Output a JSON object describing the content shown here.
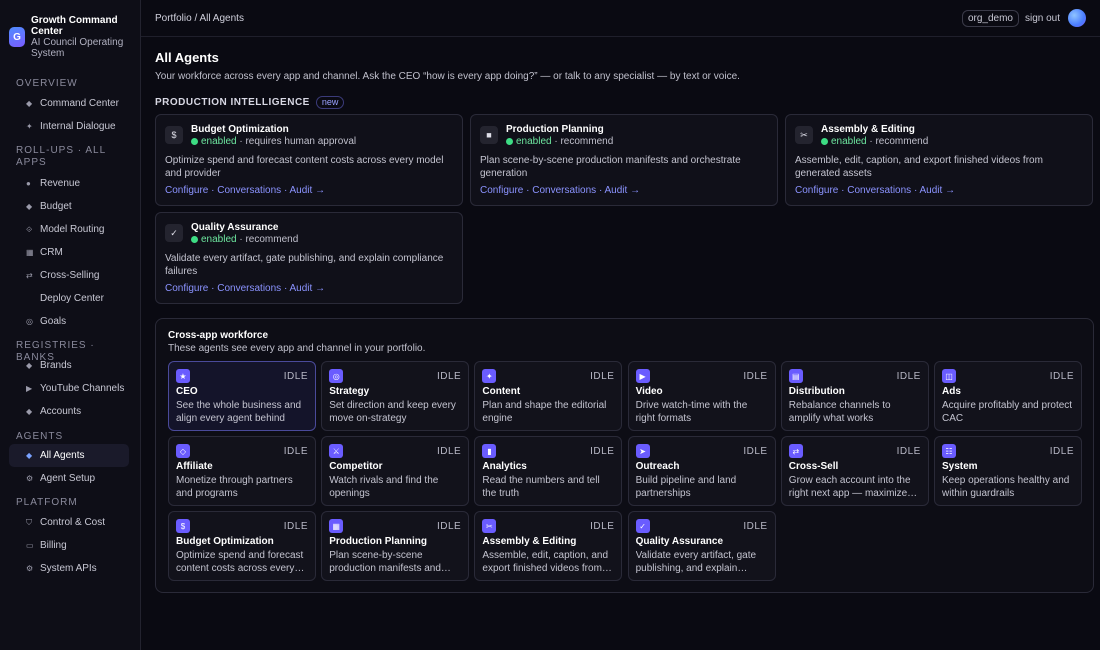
{
  "brand": {
    "logo": "G",
    "title": "Growth Command Center",
    "subtitle": "AI Council Operating System"
  },
  "sidebar": {
    "sections": [
      {
        "label": "OVERVIEW",
        "items": [
          {
            "label": "Command Center",
            "icon": "diamond-icon"
          },
          {
            "label": "Internal Dialogue",
            "icon": "sparkle-icon"
          }
        ]
      },
      {
        "label": "ROLL-UPS · ALL APPS",
        "items": [
          {
            "label": "Revenue",
            "icon": "circle-icon"
          },
          {
            "label": "Budget",
            "icon": "diamond-icon"
          },
          {
            "label": "Model Routing",
            "icon": "route-icon"
          },
          {
            "label": "CRM",
            "icon": "grid-icon"
          },
          {
            "label": "Cross-Selling",
            "icon": "swap-icon"
          },
          {
            "label": "Deploy Center",
            "icon": ""
          },
          {
            "label": "Goals",
            "icon": "target-icon"
          }
        ]
      },
      {
        "label": "REGISTRIES · BANKS",
        "items": [
          {
            "label": "Brands",
            "icon": "diamond-icon"
          },
          {
            "label": "YouTube Channels",
            "icon": "play-icon"
          },
          {
            "label": "Accounts",
            "icon": "diamond-icon"
          }
        ]
      },
      {
        "label": "AGENTS",
        "items": [
          {
            "label": "All Agents",
            "icon": "diamond-icon",
            "active": true
          },
          {
            "label": "Agent Setup",
            "icon": "gear-icon"
          }
        ]
      },
      {
        "label": "PLATFORM",
        "items": [
          {
            "label": "Control & Cost",
            "icon": "shield-icon"
          },
          {
            "label": "Billing",
            "icon": "card-icon"
          },
          {
            "label": "System APIs",
            "icon": "gear-icon"
          }
        ]
      }
    ]
  },
  "topbar": {
    "breadcrumb": "Portfolio / All Agents",
    "org": "org_demo",
    "signout": "sign out"
  },
  "page": {
    "title": "All Agents",
    "subtitle": "Your workforce across every app and channel. Ask the CEO “how is every app doing?” — or talk to any specialist — by text or voice."
  },
  "production": {
    "title": "PRODUCTION INTELLIGENCE",
    "badge": "new",
    "cards": [
      {
        "name": "Budget Optimization",
        "icon_glyph": "$",
        "icon": "dollar-icon",
        "status": "enabled",
        "mode": " · requires human approval",
        "desc": "Optimize spend and forecast content costs across every model and provider"
      },
      {
        "name": "Production Planning",
        "icon_glyph": "■",
        "icon": "clipboard-icon",
        "status": "enabled",
        "mode": " · recommend",
        "desc": "Plan scene-by-scene production manifests and orchestrate generation"
      },
      {
        "name": "Assembly & Editing",
        "icon_glyph": "✂",
        "icon": "scissors-icon",
        "status": "enabled",
        "mode": " · recommend",
        "desc": "Assemble, edit, caption, and export finished videos from generated assets"
      },
      {
        "name": "Quality Assurance",
        "icon_glyph": "✓",
        "icon": "check-icon",
        "status": "enabled",
        "mode": " · recommend",
        "desc": "Validate every artifact, gate publishing, and explain compliance failures"
      }
    ],
    "links": {
      "configure": "Configure",
      "conversations": "Conversations",
      "audit": "Audit →",
      "sep": " · "
    }
  },
  "cross": {
    "title": "Cross-app workforce",
    "subtitle": "These agents see every app and channel in your portfolio.",
    "status_label": "IDLE",
    "agents": [
      {
        "name": "CEO",
        "icon_glyph": "★",
        "icon": "star-icon",
        "desc": "See the whole business and align every agent behind one…"
      },
      {
        "name": "Strategy",
        "icon_glyph": "◎",
        "icon": "compass-icon",
        "desc": "Set direction and keep every move on-strategy"
      },
      {
        "name": "Content",
        "icon_glyph": "✦",
        "icon": "sparkle-icon",
        "desc": "Plan and shape the editorial engine"
      },
      {
        "name": "Video",
        "icon_glyph": "▶",
        "icon": "play-icon",
        "desc": "Drive watch-time with the right formats"
      },
      {
        "name": "Distribution",
        "icon_glyph": "▤",
        "icon": "broadcast-icon",
        "desc": "Rebalance channels to amplify what works"
      },
      {
        "name": "Ads",
        "icon_glyph": "◫",
        "icon": "megaphone-icon",
        "desc": "Acquire profitably and protect CAC"
      },
      {
        "name": "Affiliate",
        "icon_glyph": "◇",
        "icon": "link-icon",
        "desc": "Monetize through partners and programs"
      },
      {
        "name": "Competitor",
        "icon_glyph": "⚔",
        "icon": "binoculars-icon",
        "desc": "Watch rivals and find the openings"
      },
      {
        "name": "Analytics",
        "icon_glyph": "▮",
        "icon": "chart-icon",
        "desc": "Read the numbers and tell the truth"
      },
      {
        "name": "Outreach",
        "icon_glyph": "➤",
        "icon": "send-icon",
        "desc": "Build pipeline and land partnerships"
      },
      {
        "name": "Cross-Sell",
        "icon_glyph": "⇄",
        "icon": "swap-icon",
        "desc": "Grow each account into the right next app — maximize…"
      },
      {
        "name": "System",
        "icon_glyph": "☷",
        "icon": "server-icon",
        "desc": "Keep operations healthy and within guardrails"
      },
      {
        "name": "Budget Optimization",
        "icon_glyph": "$",
        "icon": "dollar-icon",
        "desc": "Optimize spend and forecast content costs across every…"
      },
      {
        "name": "Production Planning",
        "icon_glyph": "▦",
        "icon": "clipboard-icon",
        "desc": "Plan scene-by-scene production manifests and…"
      },
      {
        "name": "Assembly & Editing",
        "icon_glyph": "✂",
        "icon": "scissors-icon",
        "desc": "Assemble, edit, caption, and export finished videos from…"
      },
      {
        "name": "Quality Assurance",
        "icon_glyph": "✓",
        "icon": "check-icon",
        "desc": "Validate every artifact, gate publishing, and explain…"
      }
    ]
  }
}
